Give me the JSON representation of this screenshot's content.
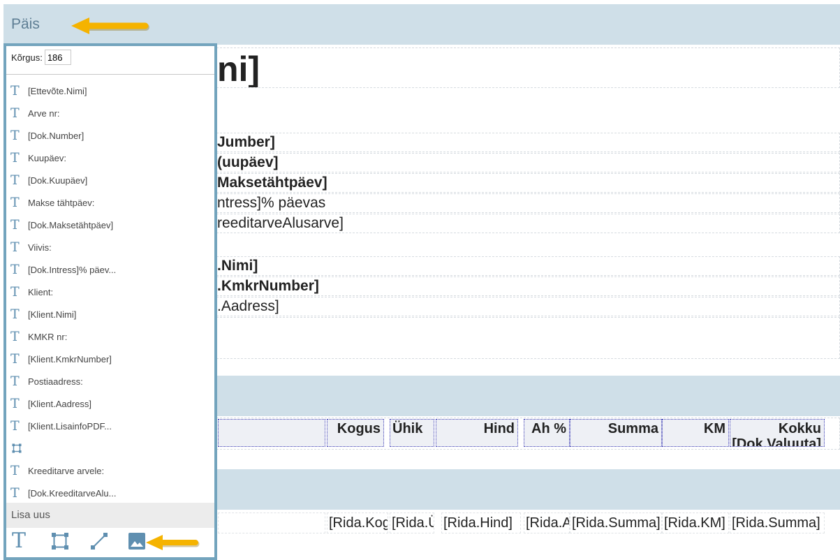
{
  "sections": {
    "header_title": "Päis"
  },
  "height": {
    "label": "Kõrgus:",
    "value": "186"
  },
  "elements": [
    {
      "type": "text",
      "label": "[Ettevõte.Nimi]"
    },
    {
      "type": "text",
      "label": "Arve nr:"
    },
    {
      "type": "text",
      "label": "[Dok.Number]"
    },
    {
      "type": "text",
      "label": "Kuupäev:"
    },
    {
      "type": "text",
      "label": "[Dok.Kuupäev]"
    },
    {
      "type": "text",
      "label": "Makse tähtpäev:"
    },
    {
      "type": "text",
      "label": "[Dok.Maksetähtpäev]"
    },
    {
      "type": "text",
      "label": "Viivis:"
    },
    {
      "type": "text",
      "label": "[Dok.Intress]% päev..."
    },
    {
      "type": "text",
      "label": "Klient:"
    },
    {
      "type": "text",
      "label": "[Klient.Nimi]"
    },
    {
      "type": "text",
      "label": "KMKR nr:"
    },
    {
      "type": "text",
      "label": "[Klient.KmkrNumber]"
    },
    {
      "type": "text",
      "label": "Postiaadress:"
    },
    {
      "type": "text",
      "label": "[Klient.Aadress]"
    },
    {
      "type": "text",
      "label": "[Klient.LisainfoPDF..."
    },
    {
      "type": "rectangle",
      "label": ""
    },
    {
      "type": "text",
      "label": "Kreeditarve arvele:"
    },
    {
      "type": "text",
      "label": "[Dok.KreeditarveAlu..."
    }
  ],
  "add_new": {
    "label": "Lisa uus",
    "tools": [
      "text-tool-icon",
      "rectangle-tool-icon",
      "line-tool-icon",
      "image-tool-icon"
    ]
  },
  "canvas": {
    "company_name": "ni]",
    "dok_number": "Jumber]",
    "dok_date": "(uupäev]",
    "dok_due": "Maksetähtpäev]",
    "dok_interest": "ntress]% päevas",
    "dok_credit": "reeditarveAlusarve]",
    "client_name": ".Nimi]",
    "client_kmkr": ".KmkrNumber]",
    "client_address": ".Aadress]"
  },
  "table_header": {
    "kogus": "Kogus",
    "uhik": "Ühik",
    "hind": "Hind",
    "ah": "Ah %",
    "summa": "Summa",
    "km": "KM",
    "kokku": "Kokku [Dok.Valuuta]"
  },
  "table_row": {
    "kogus": "[Rida.Kogus]",
    "uhik": "[Rida.Ühik]",
    "hind": "[Rida.Hind]",
    "ah": "[Rida.Ah]",
    "summa": "[Rida.Summa]",
    "km": "[Rida.KM]",
    "kokku": "[Rida.Summa]"
  },
  "colors": {
    "band": "#cfdfe8",
    "panel_border": "#73a4bd",
    "icon": "#5f8fb0",
    "arrow": "#f5b300"
  }
}
